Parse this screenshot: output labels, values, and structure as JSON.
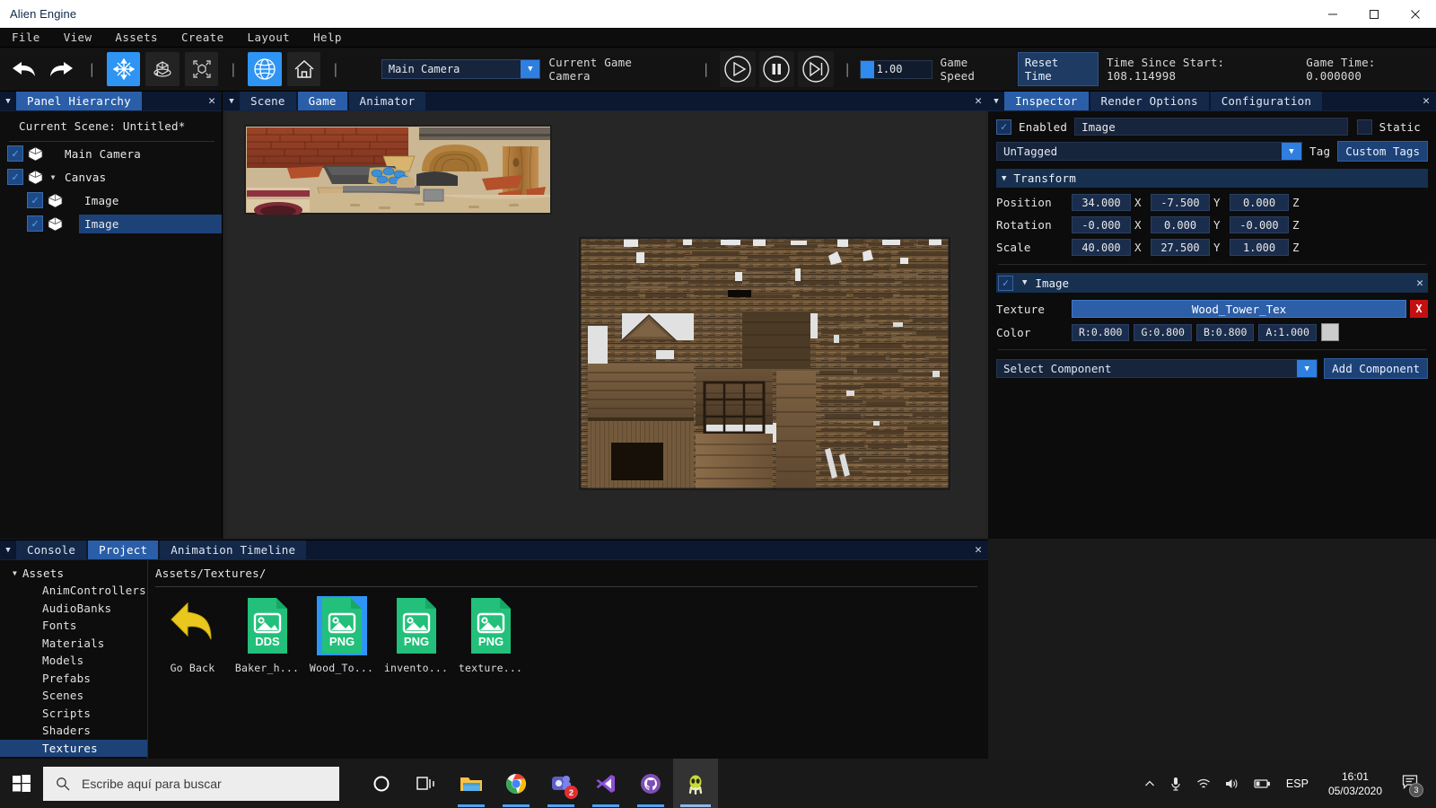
{
  "window": {
    "title": "Alien Engine",
    "minimize": "—",
    "maximize": "☐",
    "close": "✕"
  },
  "menu": {
    "items": [
      "File",
      "View",
      "Assets",
      "Create",
      "Layout",
      "Help"
    ]
  },
  "toolbar": {
    "undo_icon": "undo-arrow",
    "redo_icon": "redo-arrow",
    "gizmos": [
      {
        "name": "move-tool",
        "active": true
      },
      {
        "name": "rotate-tool",
        "active": false
      },
      {
        "name": "scale-tool",
        "active": false
      }
    ],
    "space_toggle": {
      "name": "global-space",
      "active": true
    },
    "home_button": {
      "name": "home-view",
      "active": false
    },
    "camera_value": "Main Camera",
    "camera_label": "Current Game Camera",
    "play_label": "play",
    "pause_label": "pause",
    "step_label": "step",
    "game_speed_value": "1.00",
    "game_speed_label": "Game Speed",
    "reset_time_label": "Reset Time",
    "time_since_start": "Time Since Start: 108.114998",
    "game_time": "Game Time: 0.000000"
  },
  "hierarchy": {
    "tab_label": "Panel Hierarchy",
    "close_label": "✕",
    "current_scene": "Current Scene: Untitled*",
    "items": [
      {
        "label": "Main Camera",
        "checked": true,
        "depth": 0,
        "expandable": false,
        "selected": false
      },
      {
        "label": "Canvas",
        "checked": true,
        "depth": 0,
        "expandable": true,
        "selected": false
      },
      {
        "label": "Image",
        "checked": true,
        "depth": 1,
        "expandable": false,
        "selected": false
      },
      {
        "label": "Image",
        "checked": true,
        "depth": 1,
        "expandable": false,
        "selected": true
      }
    ]
  },
  "viewport": {
    "tabs": [
      {
        "label": "Scene",
        "active": false
      },
      {
        "label": "Game",
        "active": true
      },
      {
        "label": "Animator",
        "active": false
      }
    ],
    "close_label": "✕"
  },
  "inspector": {
    "tabs": [
      {
        "label": "Inspector",
        "active": true
      },
      {
        "label": "Render Options",
        "active": false
      },
      {
        "label": "Configuration",
        "active": false
      }
    ],
    "close_label": "✕",
    "enabled_checked": true,
    "enabled_label": "Enabled",
    "object_name": "Image",
    "static_checked": false,
    "static_label": "Static",
    "tag_value": "UnTagged",
    "tag_label": "Tag",
    "custom_tags_label": "Custom Tags",
    "transform": {
      "title": "Transform",
      "rows": [
        {
          "label": "Position",
          "x": "34.000",
          "y": "-7.500",
          "z": "0.000"
        },
        {
          "label": "Rotation",
          "x": "-0.000",
          "y": "0.000",
          "z": "-0.000"
        },
        {
          "label": "Scale",
          "x": "40.000",
          "y": "27.500",
          "z": "1.000"
        }
      ],
      "axis_x": "X",
      "axis_y": "Y",
      "axis_z": "Z"
    },
    "image_component": {
      "title": "Image",
      "enabled": true,
      "close_label": "✕",
      "texture_label": "Texture",
      "texture_value": "Wood_Tower_Tex",
      "texture_delete_label": "X",
      "color_label": "Color",
      "color_r": "R:0.800",
      "color_g": "G:0.800",
      "color_b": "B:0.800",
      "color_a": "A:1.000",
      "color_swatch": "#cccccc"
    },
    "select_component_value": "Select Component",
    "add_component_label": "Add Component"
  },
  "project": {
    "tabs": [
      {
        "label": "Console",
        "active": false
      },
      {
        "label": "Project",
        "active": true
      },
      {
        "label": "Animation Timeline",
        "active": false
      }
    ],
    "close_label": "✕",
    "tree_root": "Assets",
    "tree_items": [
      {
        "label": "AnimControllers",
        "selected": false
      },
      {
        "label": "AudioBanks",
        "selected": false
      },
      {
        "label": "Fonts",
        "selected": false
      },
      {
        "label": "Materials",
        "selected": false
      },
      {
        "label": "Models",
        "selected": false
      },
      {
        "label": "Prefabs",
        "selected": false
      },
      {
        "label": "Scenes",
        "selected": false
      },
      {
        "label": "Scripts",
        "selected": false
      },
      {
        "label": "Shaders",
        "selected": false
      },
      {
        "label": "Textures",
        "selected": true
      }
    ],
    "breadcrumb": "Assets/Textures/",
    "files": [
      {
        "name": "Go Back",
        "type": "back",
        "selected": false
      },
      {
        "name": "Baker_h...",
        "type": "DDS",
        "selected": false
      },
      {
        "name": "Wood_To...",
        "type": "PNG",
        "selected": true
      },
      {
        "name": "invento...",
        "type": "PNG",
        "selected": false
      },
      {
        "name": "texture...",
        "type": "PNG",
        "selected": false
      }
    ]
  },
  "taskbar": {
    "search_placeholder": "Escribe aquí para buscar",
    "apps": [
      {
        "name": "cortana",
        "running": false,
        "active": false
      },
      {
        "name": "task-view",
        "running": false,
        "active": false
      },
      {
        "name": "file-explorer",
        "running": true,
        "active": false
      },
      {
        "name": "chrome",
        "running": true,
        "active": false
      },
      {
        "name": "teams",
        "running": true,
        "active": false,
        "badge": "2"
      },
      {
        "name": "vscode",
        "running": true,
        "active": false
      },
      {
        "name": "github-desktop",
        "running": true,
        "active": false
      },
      {
        "name": "alien-engine",
        "running": false,
        "active": true
      }
    ],
    "language": "ESP",
    "time": "16:01",
    "date": "05/03/2020",
    "notification_count": "3"
  }
}
